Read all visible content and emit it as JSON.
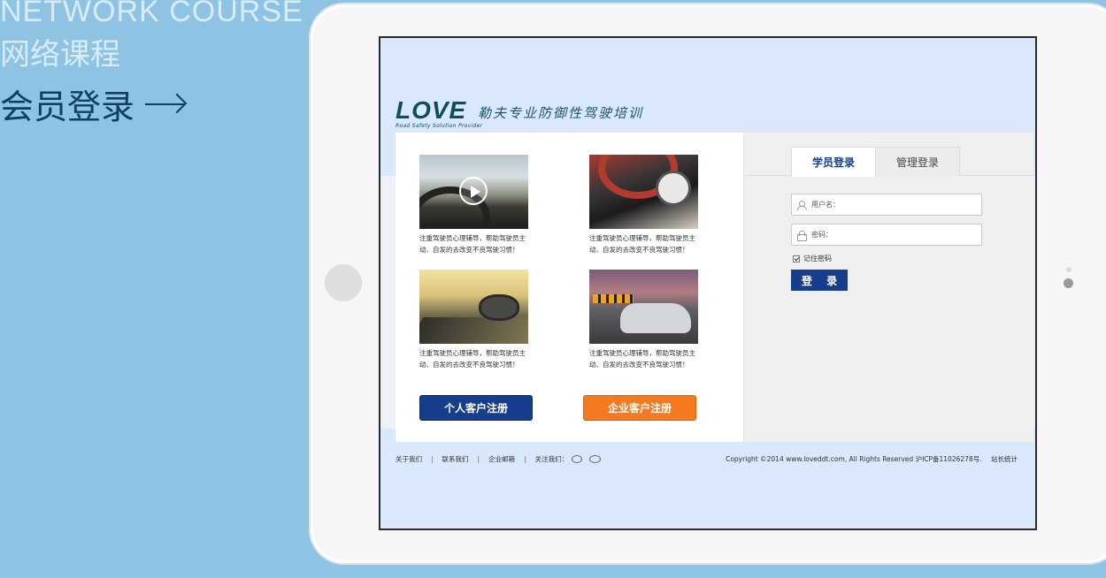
{
  "hero": {
    "title_en": "NETWORK COURSE",
    "title_cn": "网络课程",
    "login_heading": "会员登录"
  },
  "brand": {
    "logo_text": "LOVE",
    "logo_subtitle": "Road Safety Solution Provider",
    "slogan": "勒夫专业防御性驾驶培训"
  },
  "tiles": [
    {
      "caption": "注重驾驶员心理辅导，帮助驾驶员主动、自发的去改变不良驾驶习惯！",
      "image": "video-steering-wheel"
    },
    {
      "caption": "注重驾驶员心理辅导，帮助驾驶员主动、自发的去改变不良驾驶习惯！",
      "image": "dashboard"
    },
    {
      "caption": "注重驾驶员心理辅导，帮助驾驶员主动、自发的去改变不良驾驶习惯！",
      "image": "side-mirror"
    },
    {
      "caption": "注重驾驶员心理辅导，帮助驾驶员主动、自发的去改变不良驾驶习惯！",
      "image": "silver-car"
    }
  ],
  "register": {
    "personal": "个人客户注册",
    "enterprise": "企业客户注册"
  },
  "login": {
    "tab_student": "学员登录",
    "tab_admin": "管理登录",
    "username_placeholder": "用户名：",
    "password_placeholder": "密码：",
    "remember_label": "记住密码",
    "remember_checked": true,
    "submit": "登 录"
  },
  "footer": {
    "about": "关于我们",
    "contact": "联系我们",
    "mail": "企业邮箱",
    "follow": "关注我们：",
    "copyright": "Copyright ©2014 www.loveddt.com, All Rights Reserved 沪ICP备11026278号.",
    "stats": "站长统计"
  },
  "colors": {
    "page_bg": "#8ec3e3",
    "primary_blue": "#173e8c",
    "orange": "#f47a1f",
    "screen_bg": "#d9e8fb"
  },
  "icons": [
    "arrow-right-icon",
    "play-icon",
    "user-icon",
    "lock-icon",
    "weibo-icon",
    "wechat-icon"
  ]
}
